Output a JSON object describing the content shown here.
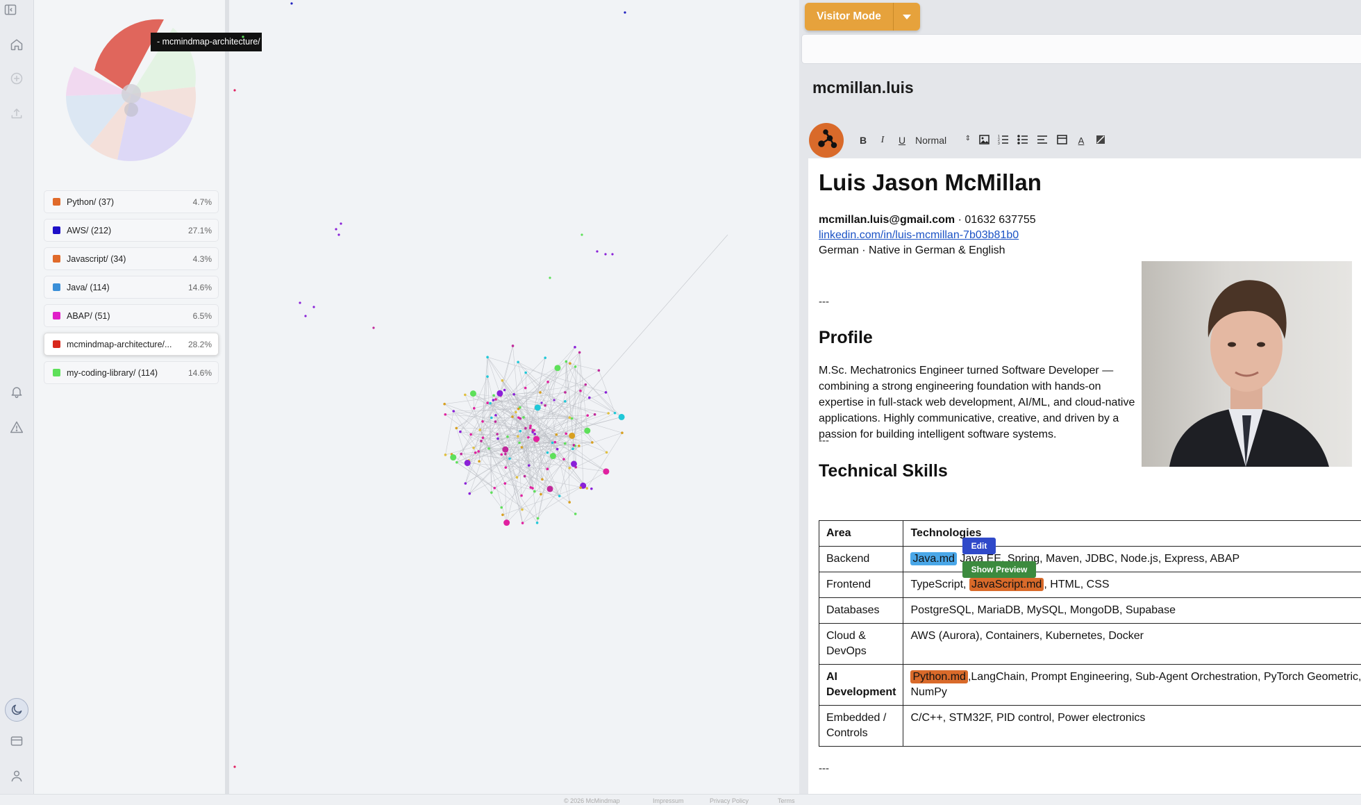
{
  "visitor_mode": {
    "label": "Visitor Mode"
  },
  "tooltip": "- mcmindmap-architecture/",
  "legend": [
    {
      "label": "Python/ (37)",
      "percent": "4.7%",
      "color": "#e06a2a"
    },
    {
      "label": "AWS/ (212)",
      "percent": "27.1%",
      "color": "#1e10c8"
    },
    {
      "label": "Javascript/ (34)",
      "percent": "4.3%",
      "color": "#e06a2a"
    },
    {
      "label": "Java/ (114)",
      "percent": "14.6%",
      "color": "#3a8fd8"
    },
    {
      "label": "ABAP/ (51)",
      "percent": "6.5%",
      "color": "#e020c8"
    },
    {
      "label": "mcmindmap-architecture/...",
      "percent": "28.2%",
      "color": "#d8281c"
    },
    {
      "label": "my-coding-library/ (114)",
      "percent": "14.6%",
      "color": "#5ee05a"
    }
  ],
  "document": {
    "title": "mcmillan.luis",
    "toolbar": {
      "bold": "B",
      "italic": "I",
      "underline": "U",
      "format": "Normal"
    },
    "name": "Luis Jason McMillan",
    "email": "mcmillan.luis@gmail.com",
    "phone": "· 01632 637755",
    "linkedin": "linkedin.com/in/luis-mcmillan-7b03b81b0",
    "languages": "German · Native in German & English",
    "separator": "---",
    "profile_heading": "Profile",
    "profile_text": "M.Sc. Mechatronics Engineer turned Software Developer — combining a strong engineering foundation with hands-on expertise in full-stack web development, AI/ML, and cloud-native applications. Highly communicative, creative, and driven by a passion for building intelligent software systems.",
    "skills_heading": "Technical Skills",
    "table": {
      "headers": [
        "Area",
        "Technologies"
      ],
      "backend": {
        "area": "Backend",
        "chip": "Java.md",
        "rest": " Java EE, Spring, Maven, JDBC, Node.js, Express, ABAP"
      },
      "frontend": {
        "area": "Frontend",
        "pre": "TypeScript, ",
        "chip": "JavaScript.md",
        "rest": ", HTML, CSS"
      },
      "databases": {
        "area": "Databases",
        "tech": "PostgreSQL, MariaDB, MySQL, MongoDB, Supabase"
      },
      "cloud": {
        "area": "Cloud & DevOps",
        "tech": "AWS (Aurora), Containers, Kubernetes, Docker"
      },
      "ai": {
        "area": "AI Development",
        "chip": "Python.md",
        "rest": ",LangChain, Prompt Engineering, Sub-Agent Orchestration, PyTorch Geometric, NumPy"
      },
      "embedded": {
        "area": "Embedded / Controls",
        "tech": "C/C++, STM32F, PID control, Power electronics"
      }
    }
  },
  "popovers": {
    "edit": "Edit",
    "preview": "Show Preview"
  },
  "footer": [
    "© 2026 McMindmap",
    "Impressum",
    "Privacy Policy",
    "Terms"
  ]
}
